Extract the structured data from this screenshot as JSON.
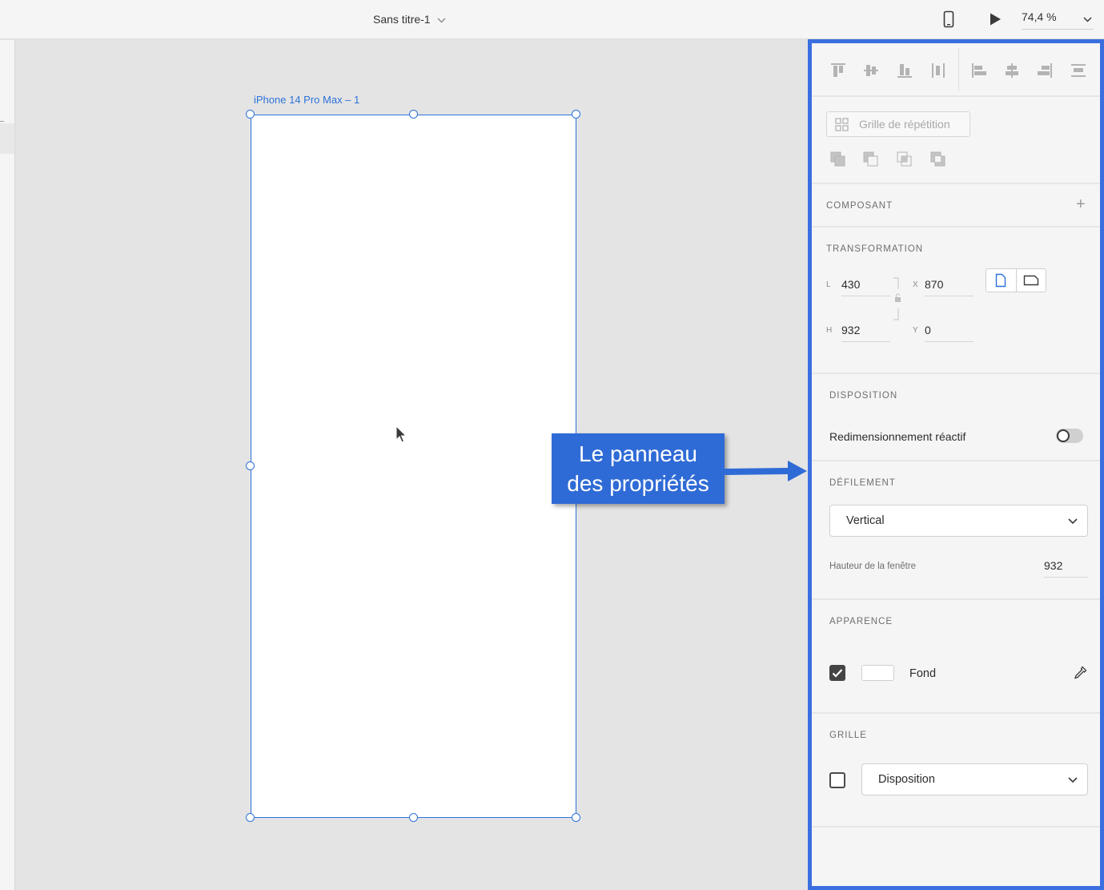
{
  "topbar": {
    "doc_title": "Sans titre-1",
    "zoom": "74,4 %",
    "icons": [
      "device-preview-icon",
      "play-icon",
      "chevron-down-icon"
    ]
  },
  "artboard": {
    "label": "iPhone 14 Pro Max – 1",
    "selection_color": "#2d72d9"
  },
  "callout": {
    "line1": "Le panneau",
    "line2": "des propriétés",
    "color": "#2f6bd6"
  },
  "panel": {
    "border_color": "#3b6fe0",
    "repeat_grid_label": "Grille de répétition",
    "component": {
      "title": "COMPOSANT",
      "add": "+"
    },
    "transform": {
      "title": "TRANSFORMATION",
      "w_label": "L",
      "w_value": "430",
      "h_label": "H",
      "h_value": "932",
      "x_label": "X",
      "x_value": "870",
      "y_label": "Y",
      "y_value": "0"
    },
    "layout": {
      "title": "DISPOSITION",
      "responsive_resize": "Redimensionnement réactif",
      "responsive_resize_on": false
    },
    "scroll": {
      "title": "DÉFILEMENT",
      "mode": "Vertical",
      "viewport_label": "Hauteur de la fenêtre",
      "viewport_value": "932"
    },
    "appearance": {
      "title": "APPARENCE",
      "fill_label": "Fond",
      "fill_checked": true,
      "fill_color": "#ffffff"
    },
    "grid": {
      "title": "GRILLE",
      "checked": false,
      "type": "Disposition"
    }
  }
}
